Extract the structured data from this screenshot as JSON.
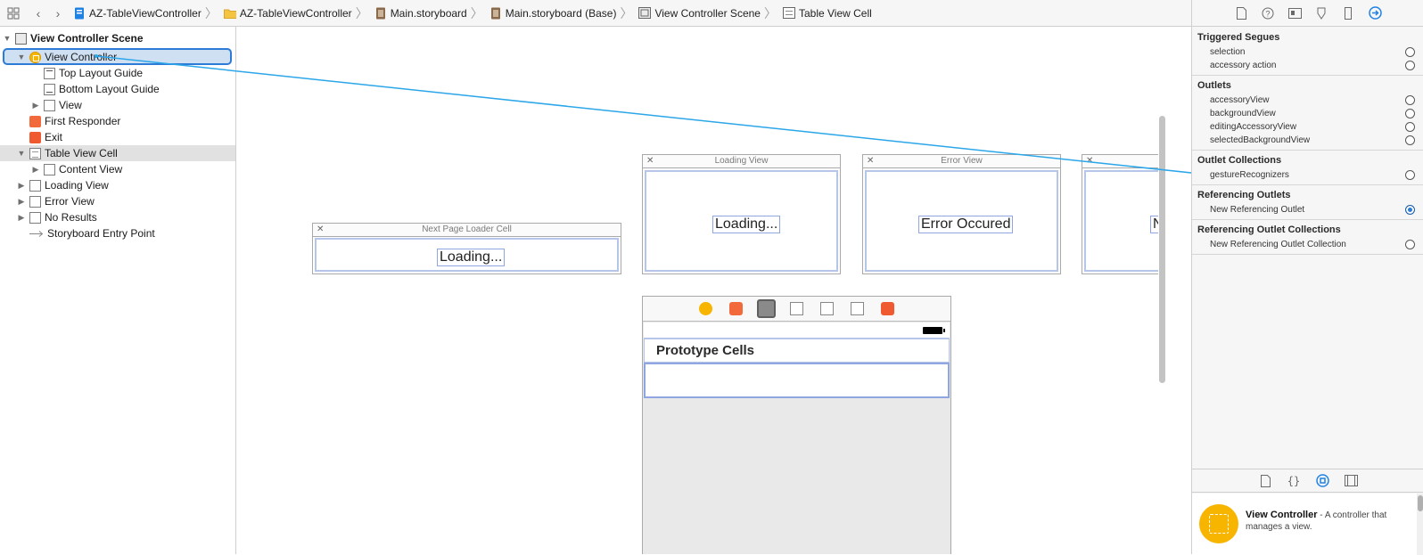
{
  "jumpbar": {
    "crumbs": [
      {
        "label": "AZ-TableViewController",
        "icon": "project-icon"
      },
      {
        "label": "AZ-TableViewController",
        "icon": "folder-icon"
      },
      {
        "label": "Main.storyboard",
        "icon": "storyboard-icon"
      },
      {
        "label": "Main.storyboard (Base)",
        "icon": "storyboard-icon"
      },
      {
        "label": "View Controller Scene",
        "icon": "scene-icon"
      },
      {
        "label": "Table View Cell",
        "icon": "table-cell-icon"
      }
    ]
  },
  "outline": {
    "items": [
      {
        "label": "View Controller Scene"
      },
      {
        "label": "View Controller"
      },
      {
        "label": "Top Layout Guide"
      },
      {
        "label": "Bottom Layout Guide"
      },
      {
        "label": "View"
      },
      {
        "label": "First Responder"
      },
      {
        "label": "Exit"
      },
      {
        "label": "Table View Cell"
      },
      {
        "label": "Content View"
      },
      {
        "label": "Loading View"
      },
      {
        "label": "Error View"
      },
      {
        "label": "No Results"
      },
      {
        "label": "Storyboard Entry Point"
      }
    ]
  },
  "canvas": {
    "next_page_loader": {
      "title": "Next Page Loader Cell",
      "label": "Loading..."
    },
    "loading_view": {
      "title": "Loading View",
      "label": "Loading..."
    },
    "error_view": {
      "title": "Error View",
      "label": "Error Occured"
    },
    "no_results_view": {
      "title": "",
      "label": "N"
    },
    "vc_scene": {
      "header": "Prototype Cells"
    }
  },
  "inspector": {
    "sections": [
      {
        "title": "Triggered Segues",
        "rows": [
          "selection",
          "accessory action"
        ]
      },
      {
        "title": "Outlets",
        "rows": [
          "accessoryView",
          "backgroundView",
          "editingAccessoryView",
          "selectedBackgroundView"
        ]
      },
      {
        "title": "Outlet Collections",
        "rows": [
          "gestureRecognizers"
        ]
      },
      {
        "title": "Referencing Outlets",
        "rows": [
          "New Referencing Outlet"
        ]
      },
      {
        "title": "Referencing Outlet Collections",
        "rows": [
          "New Referencing Outlet Collection"
        ]
      }
    ],
    "library": {
      "name": "View Controller",
      "description": " - A controller that manages a view."
    }
  },
  "colors": {
    "selection_blue": "#2c7bd6",
    "connection_line": "#2ba6e8",
    "vc_yellow": "#f7b500",
    "responder_orange": "#f26a3b"
  }
}
